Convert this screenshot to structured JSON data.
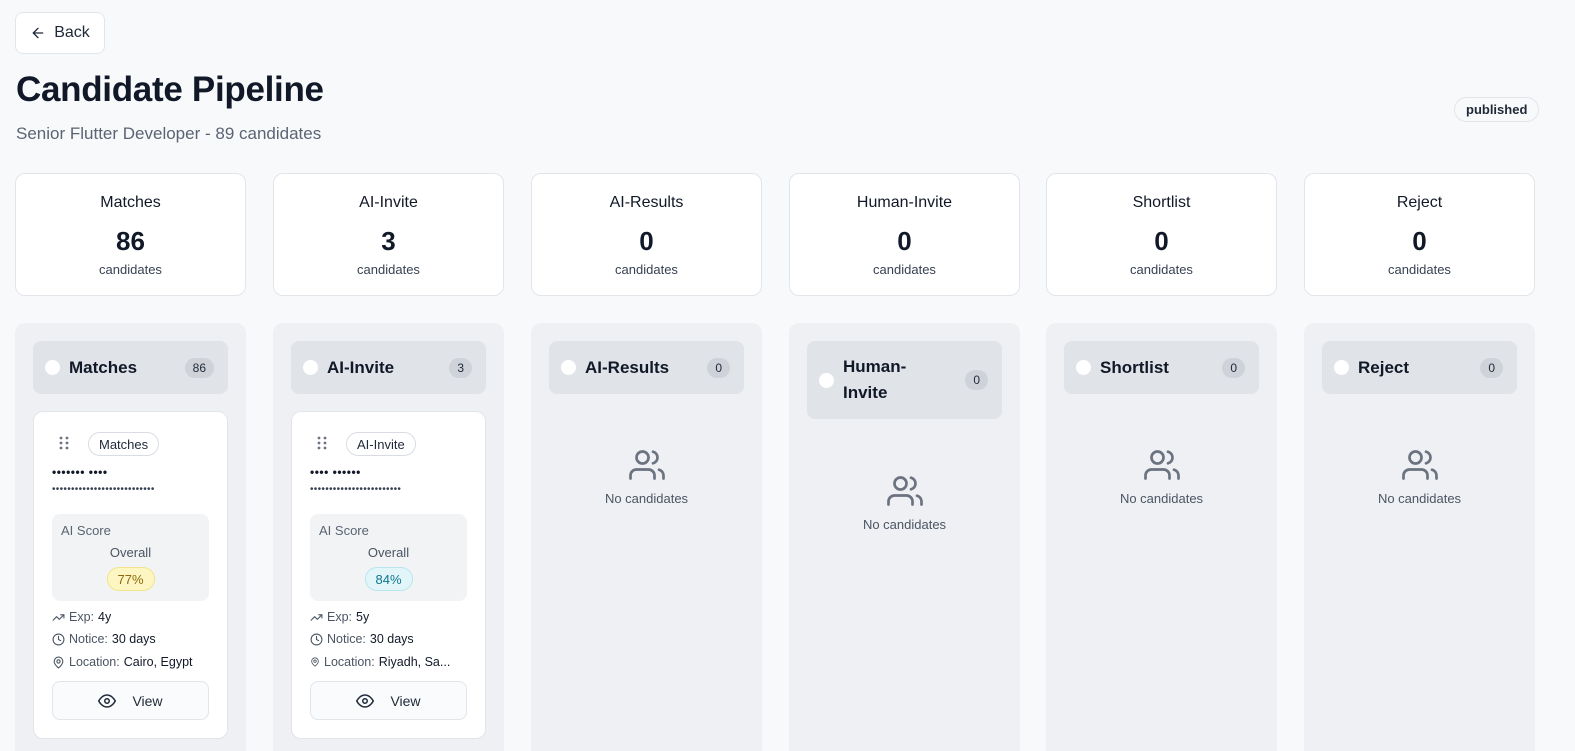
{
  "header": {
    "back_label": "Back",
    "title": "Candidate Pipeline",
    "subtitle": "Senior Flutter Developer - 89 candidates",
    "status": "published"
  },
  "stats": [
    {
      "label": "Matches",
      "value": "86",
      "unit": "candidates"
    },
    {
      "label": "AI-Invite",
      "value": "3",
      "unit": "candidates"
    },
    {
      "label": "AI-Results",
      "value": "0",
      "unit": "candidates"
    },
    {
      "label": "Human-Invite",
      "value": "0",
      "unit": "candidates"
    },
    {
      "label": "Shortlist",
      "value": "0",
      "unit": "candidates"
    },
    {
      "label": "Reject",
      "value": "0",
      "unit": "candidates"
    }
  ],
  "columns": [
    {
      "title": "Matches",
      "count": "86"
    },
    {
      "title": "AI-Invite",
      "count": "3"
    },
    {
      "title": "AI-Results",
      "count": "0",
      "empty_text": "No candidates"
    },
    {
      "title": "Human-Invite",
      "title_line1": "Human-",
      "title_line2": "Invite",
      "count": "0",
      "empty_text": "No candidates"
    },
    {
      "title": "Shortlist",
      "count": "0",
      "empty_text": "No candidates"
    },
    {
      "title": "Reject",
      "count": "0",
      "empty_text": "No candidates"
    }
  ],
  "cards": [
    {
      "tag": "Matches",
      "name_masked": "••••••• ••••",
      "email_masked": "•••••••••••••••••••••••••••",
      "score_title": "AI Score",
      "score_sub": "Overall",
      "score": "77%",
      "exp_label": "Exp:",
      "exp_value": "4y",
      "notice_label": "Notice:",
      "notice_value": "30 days",
      "location_label": "Location:",
      "location_value": "Cairo, Egypt",
      "view_label": "View"
    },
    {
      "tag": "AI-Invite",
      "name_masked": "•••• ••••••",
      "email_masked": "••••••••••••••••••••••••",
      "score_title": "AI Score",
      "score_sub": "Overall",
      "score": "84%",
      "exp_label": "Exp:",
      "exp_value": "5y",
      "notice_label": "Notice:",
      "notice_value": "30 days",
      "location_label": "Location:",
      "location_value": "Riyadh, Sa...",
      "view_label": "View"
    }
  ],
  "colors": {
    "page_bg": "#f8f9fb",
    "column_bg": "#eef0f3",
    "header_bg": "#e0e3e8",
    "score_yellow": "#fdf6c3",
    "score_cyan": "#e2f6f9"
  }
}
